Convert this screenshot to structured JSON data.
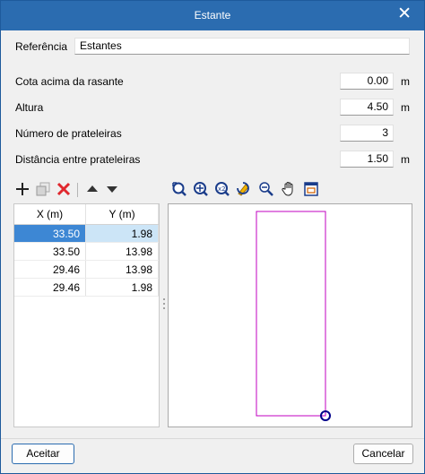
{
  "window": {
    "title": "Estante",
    "close_icon": "close-icon"
  },
  "fields": {
    "referencia": {
      "label": "Referência",
      "value": "Estantes"
    },
    "cota": {
      "label": "Cota acima da rasante",
      "value": "0.00",
      "unit": "m"
    },
    "altura": {
      "label": "Altura",
      "value": "4.50",
      "unit": "m"
    },
    "num_prateleiras": {
      "label": "Número de prateleiras",
      "value": "3"
    },
    "distancia": {
      "label": "Distância entre prateleiras",
      "value": "1.50",
      "unit": "m"
    }
  },
  "list_toolbar": [
    "add-icon",
    "copy-icon",
    "delete-icon",
    "move-up-icon",
    "move-down-icon"
  ],
  "view_toolbar": [
    "zoom-extents-icon",
    "zoom-window-icon",
    "zoom-x2-icon",
    "regenerate-icon",
    "zoom-out-icon",
    "pan-icon",
    "view-window-icon"
  ],
  "table": {
    "headers": [
      "X (m)",
      "Y (m)"
    ],
    "rows": [
      [
        "33.50",
        "1.98"
      ],
      [
        "33.50",
        "13.98"
      ],
      [
        "29.46",
        "13.98"
      ],
      [
        "29.46",
        "1.98"
      ]
    ],
    "selected_row": 0
  },
  "buttons": {
    "accept": "Aceitar",
    "cancel": "Cancelar"
  },
  "colors": {
    "titlebar": "#2b6cb0",
    "polygon": "#c000c0",
    "marker": "#00008b",
    "selection": "#3d87d4"
  }
}
